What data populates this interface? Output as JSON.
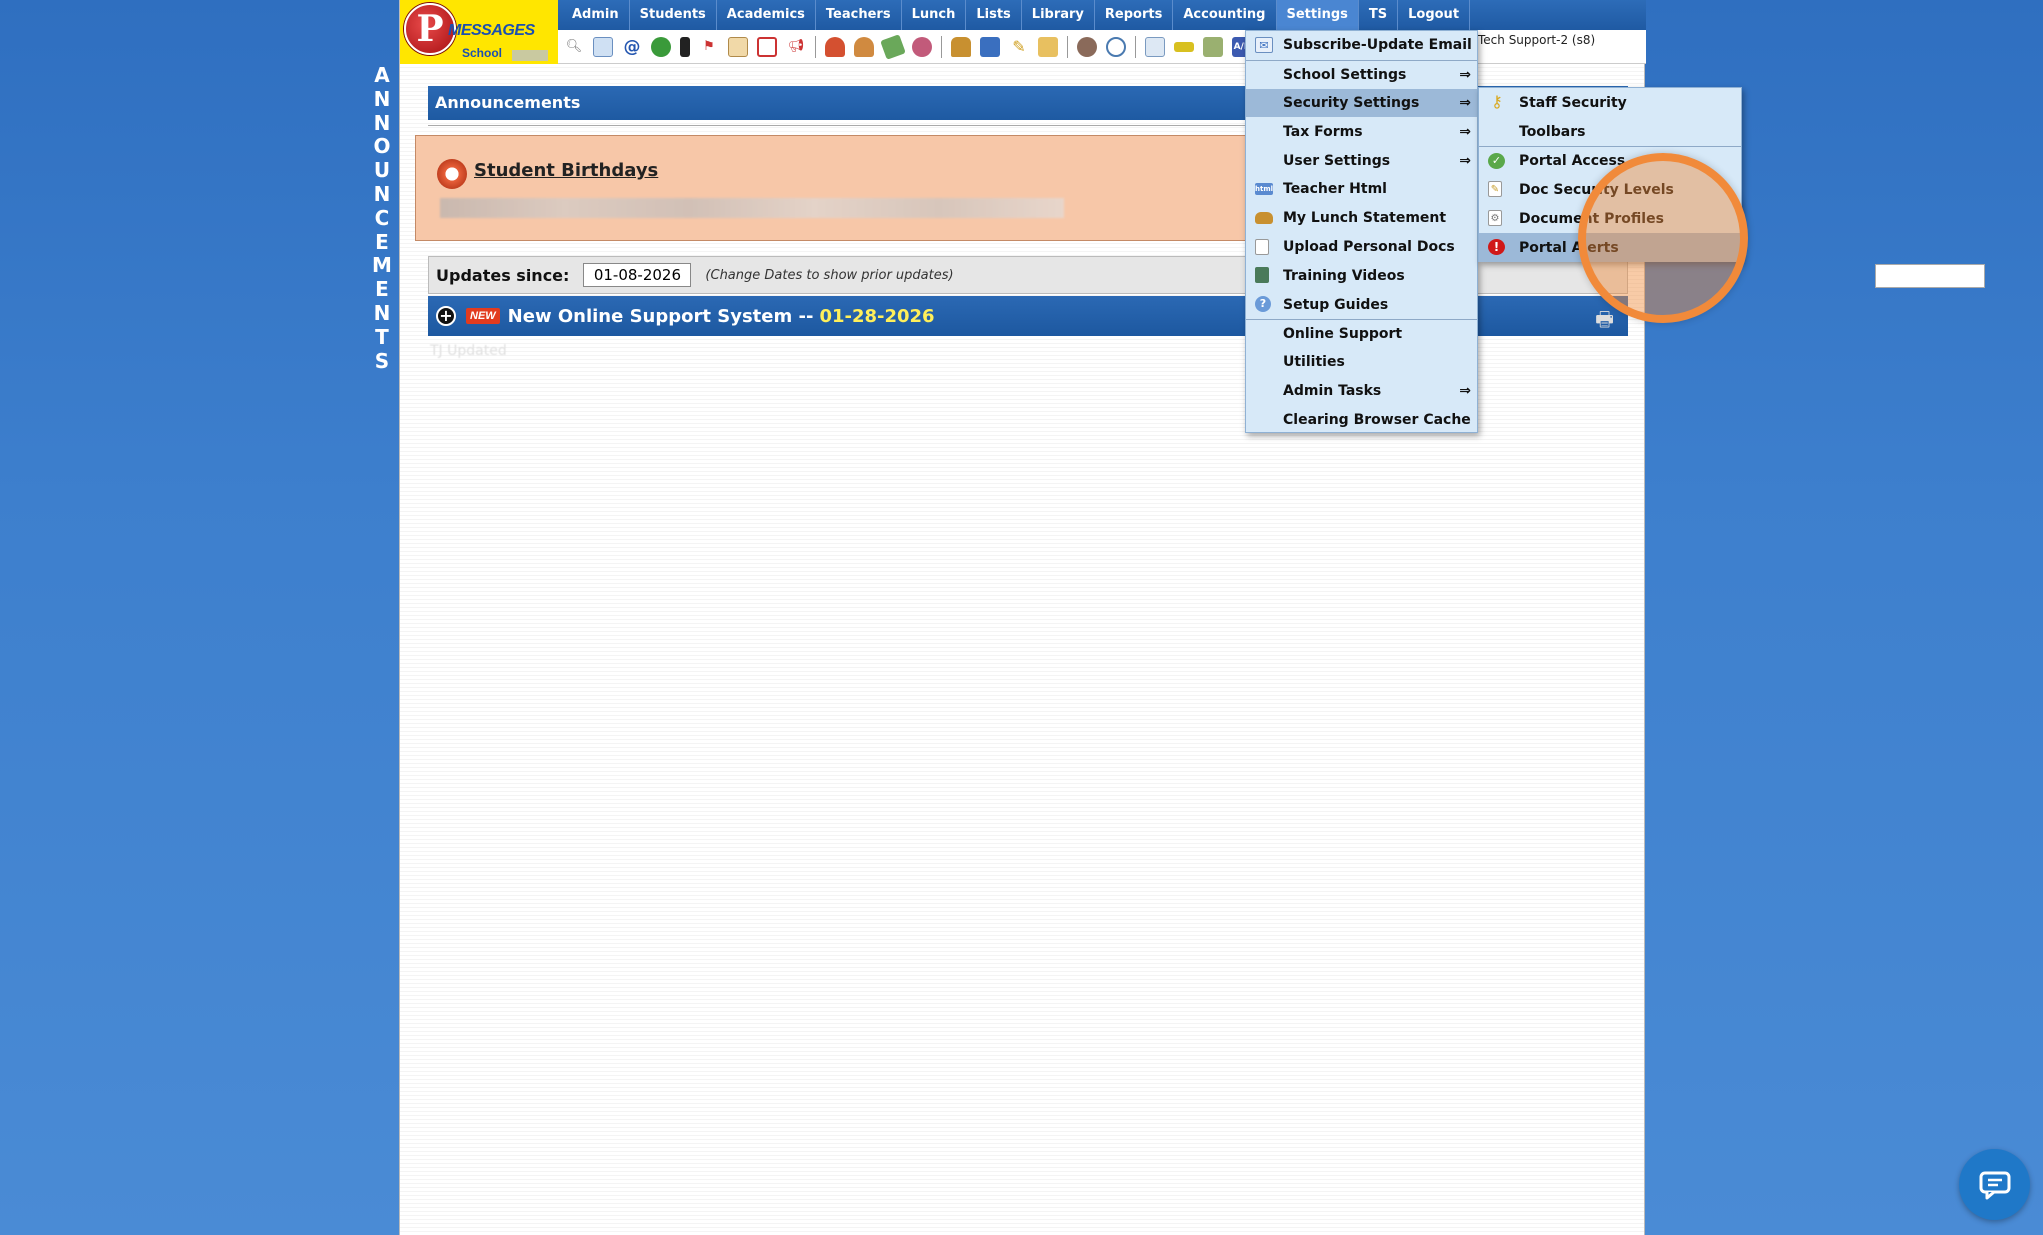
{
  "side_title": [
    "A",
    "N",
    "N",
    "O",
    "U",
    "N",
    "C",
    "E",
    "M",
    "E",
    "N",
    "T",
    "S"
  ],
  "logo": {
    "brand": "MESSAGES",
    "letter": "P",
    "school": "School"
  },
  "nav": [
    "Admin",
    "Students",
    "Academics",
    "Teachers",
    "Lunch",
    "Lists",
    "Library",
    "Reports",
    "Accounting",
    "Settings",
    "TS",
    "Logout"
  ],
  "user_label": "Tech Support-2 (s8)",
  "announcements": {
    "header": "Announcements",
    "birthdays_title": " Student Birthdays"
  },
  "updates": {
    "label": "Updates since:",
    "date": "01-08-2026",
    "hint": "(Change Dates to show prior updates)"
  },
  "news": {
    "badge": "NEW",
    "title": "New Online Support System --",
    "date": "01-28-2026"
  },
  "faded_text": "TJ Updated",
  "settings_menu": [
    {
      "label": "Subscribe-Update Email",
      "icon": "email-icon",
      "arrow": ""
    },
    {
      "label": "School Settings",
      "icon": "",
      "arrow": "⇒"
    },
    {
      "label": "Security Settings",
      "icon": "",
      "arrow": "⇒"
    },
    {
      "label": "Tax Forms",
      "icon": "",
      "arrow": "⇒"
    },
    {
      "label": "User Settings",
      "icon": "",
      "arrow": "⇒"
    },
    {
      "label": "Teacher Html",
      "icon": "html-icon",
      "arrow": ""
    },
    {
      "label": "My Lunch Statement",
      "icon": "burger-icon",
      "arrow": ""
    },
    {
      "label": "Upload Personal Docs",
      "icon": "document-icon",
      "arrow": ""
    },
    {
      "label": "Training Videos",
      "icon": "film-icon",
      "arrow": ""
    },
    {
      "label": "Setup Guides",
      "icon": "help-icon",
      "arrow": ""
    },
    {
      "label": "Online Support",
      "icon": "",
      "arrow": ""
    },
    {
      "label": "Utilities",
      "icon": "",
      "arrow": ""
    },
    {
      "label": "Admin Tasks",
      "icon": "",
      "arrow": "⇒"
    },
    {
      "label": "Clearing Browser Cache",
      "icon": "",
      "arrow": ""
    }
  ],
  "security_submenu": [
    {
      "label": "Staff Security",
      "icon": "key-icon"
    },
    {
      "label": "Toolbars",
      "icon": ""
    },
    {
      "label": "Portal Access",
      "icon": "check-circle-icon"
    },
    {
      "label": "Doc Security Levels",
      "icon": "document-edit-icon"
    },
    {
      "label": "Document Profiles",
      "icon": "document-gear-icon"
    },
    {
      "label": "Portal Alerts",
      "icon": "alert-icon"
    }
  ],
  "colors": {
    "accent": "#1f5aa3",
    "spotlight": "#f18a3a",
    "menu_bg": "#d7e9f8",
    "highlight": "#9cb9d8"
  }
}
